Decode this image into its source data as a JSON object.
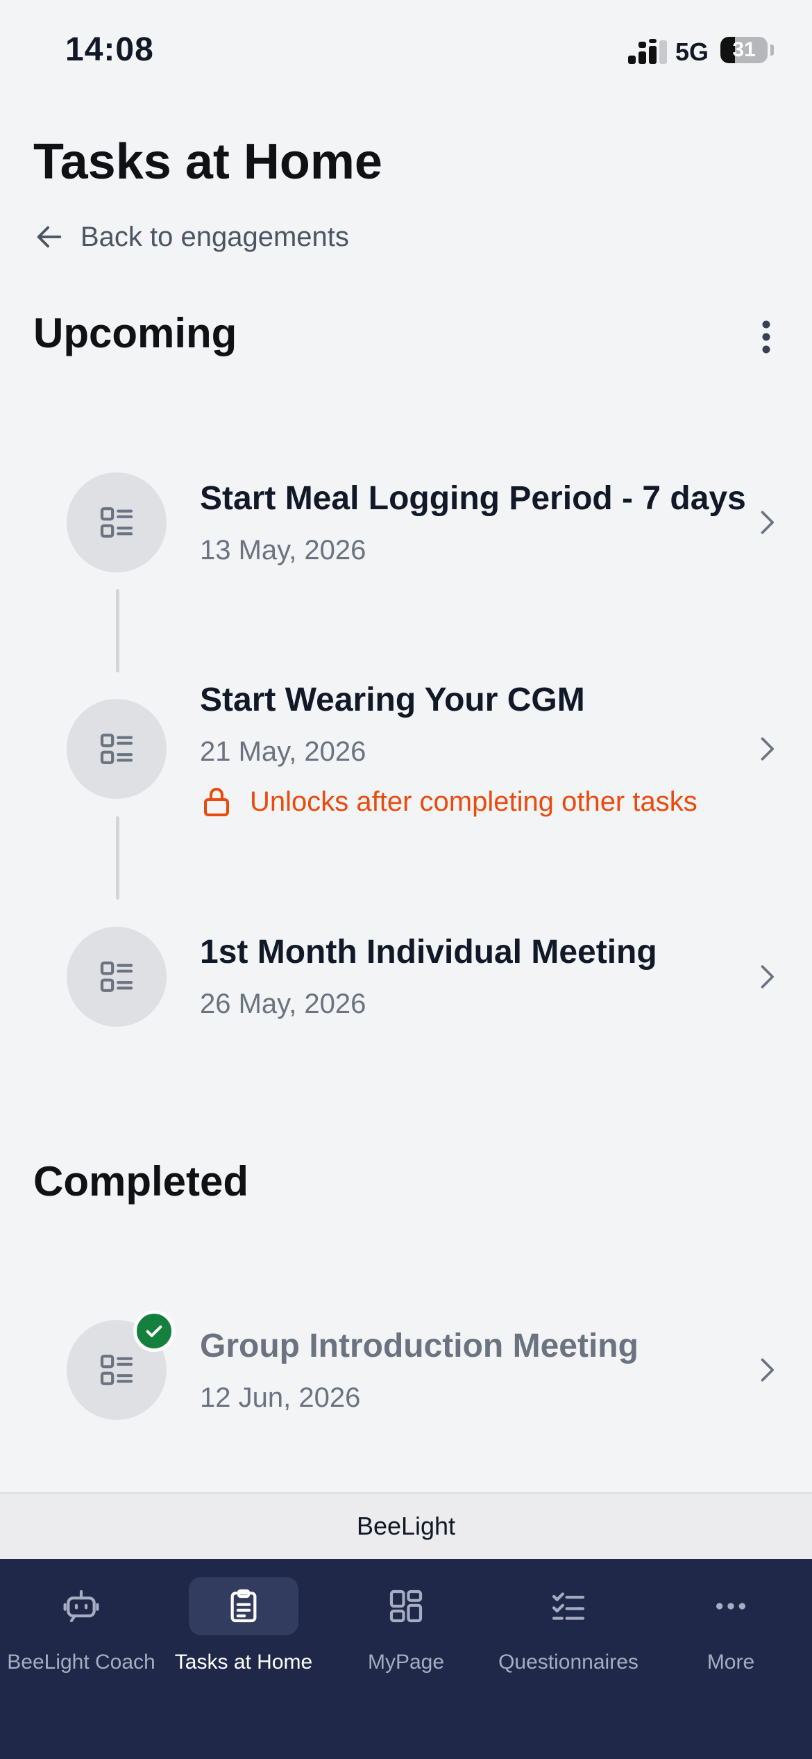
{
  "status_bar": {
    "time": "14:08",
    "network": "5G",
    "battery": "31"
  },
  "header": {
    "title": "Tasks at Home",
    "back_label": "Back to engagements"
  },
  "upcoming": {
    "title": "Upcoming",
    "tasks": [
      {
        "title": "Start Meal Logging Period - 7 days",
        "date": "13 May, 2026"
      },
      {
        "title": "Start Wearing Your CGM",
        "date": "21 May, 2026",
        "lock_note": "Unlocks after completing other tasks"
      },
      {
        "title": "1st Month Individual Meeting",
        "date": "26 May, 2026"
      }
    ]
  },
  "completed": {
    "title": "Completed",
    "tasks": [
      {
        "title": "Group Introduction Meeting",
        "date": "12 Jun, 2026",
        "status": "completed"
      }
    ]
  },
  "footer": {
    "app_name": "BeeLight"
  },
  "tab_bar": {
    "active": "Tasks at Home",
    "tabs": [
      {
        "label": "BeeLight Coach",
        "icon": "robot-icon"
      },
      {
        "label": "Tasks at Home",
        "icon": "clipboard-icon"
      },
      {
        "label": "MyPage",
        "icon": "grid-icon"
      },
      {
        "label": "Questionnaires",
        "icon": "checklist-icon"
      },
      {
        "label": "More",
        "icon": "more-dots-icon"
      }
    ]
  },
  "colors": {
    "background": "#f3f4f6",
    "warning": "#ea4a0c",
    "success": "#15803d",
    "tab_bar": "#1f2848",
    "tab_active_bg": "#323c5e"
  }
}
